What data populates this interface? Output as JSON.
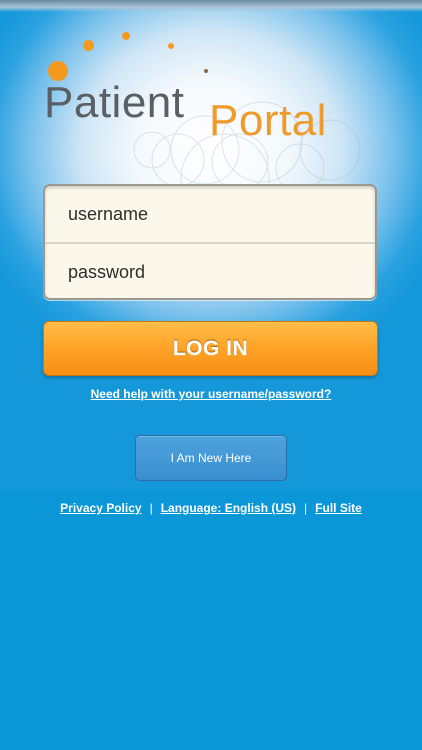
{
  "logo": {
    "word1": "Patient",
    "word2": "Portal",
    "colors": {
      "gray": "#5a5f66",
      "orange": "#ef9a2a"
    }
  },
  "login": {
    "username_placeholder": "username",
    "password_placeholder": "password",
    "button_label": "LOG IN",
    "help_link": "Need help with your username/password?"
  },
  "new_user": {
    "button_label": "I Am New Here"
  },
  "footer": {
    "privacy": "Privacy Policy",
    "separator": "|",
    "language": "Language: English (US)",
    "full_site": "Full Site"
  },
  "colors": {
    "background": "#0b96d8",
    "login_button": "#ffa52a",
    "new_button": "#3a8fcf"
  }
}
